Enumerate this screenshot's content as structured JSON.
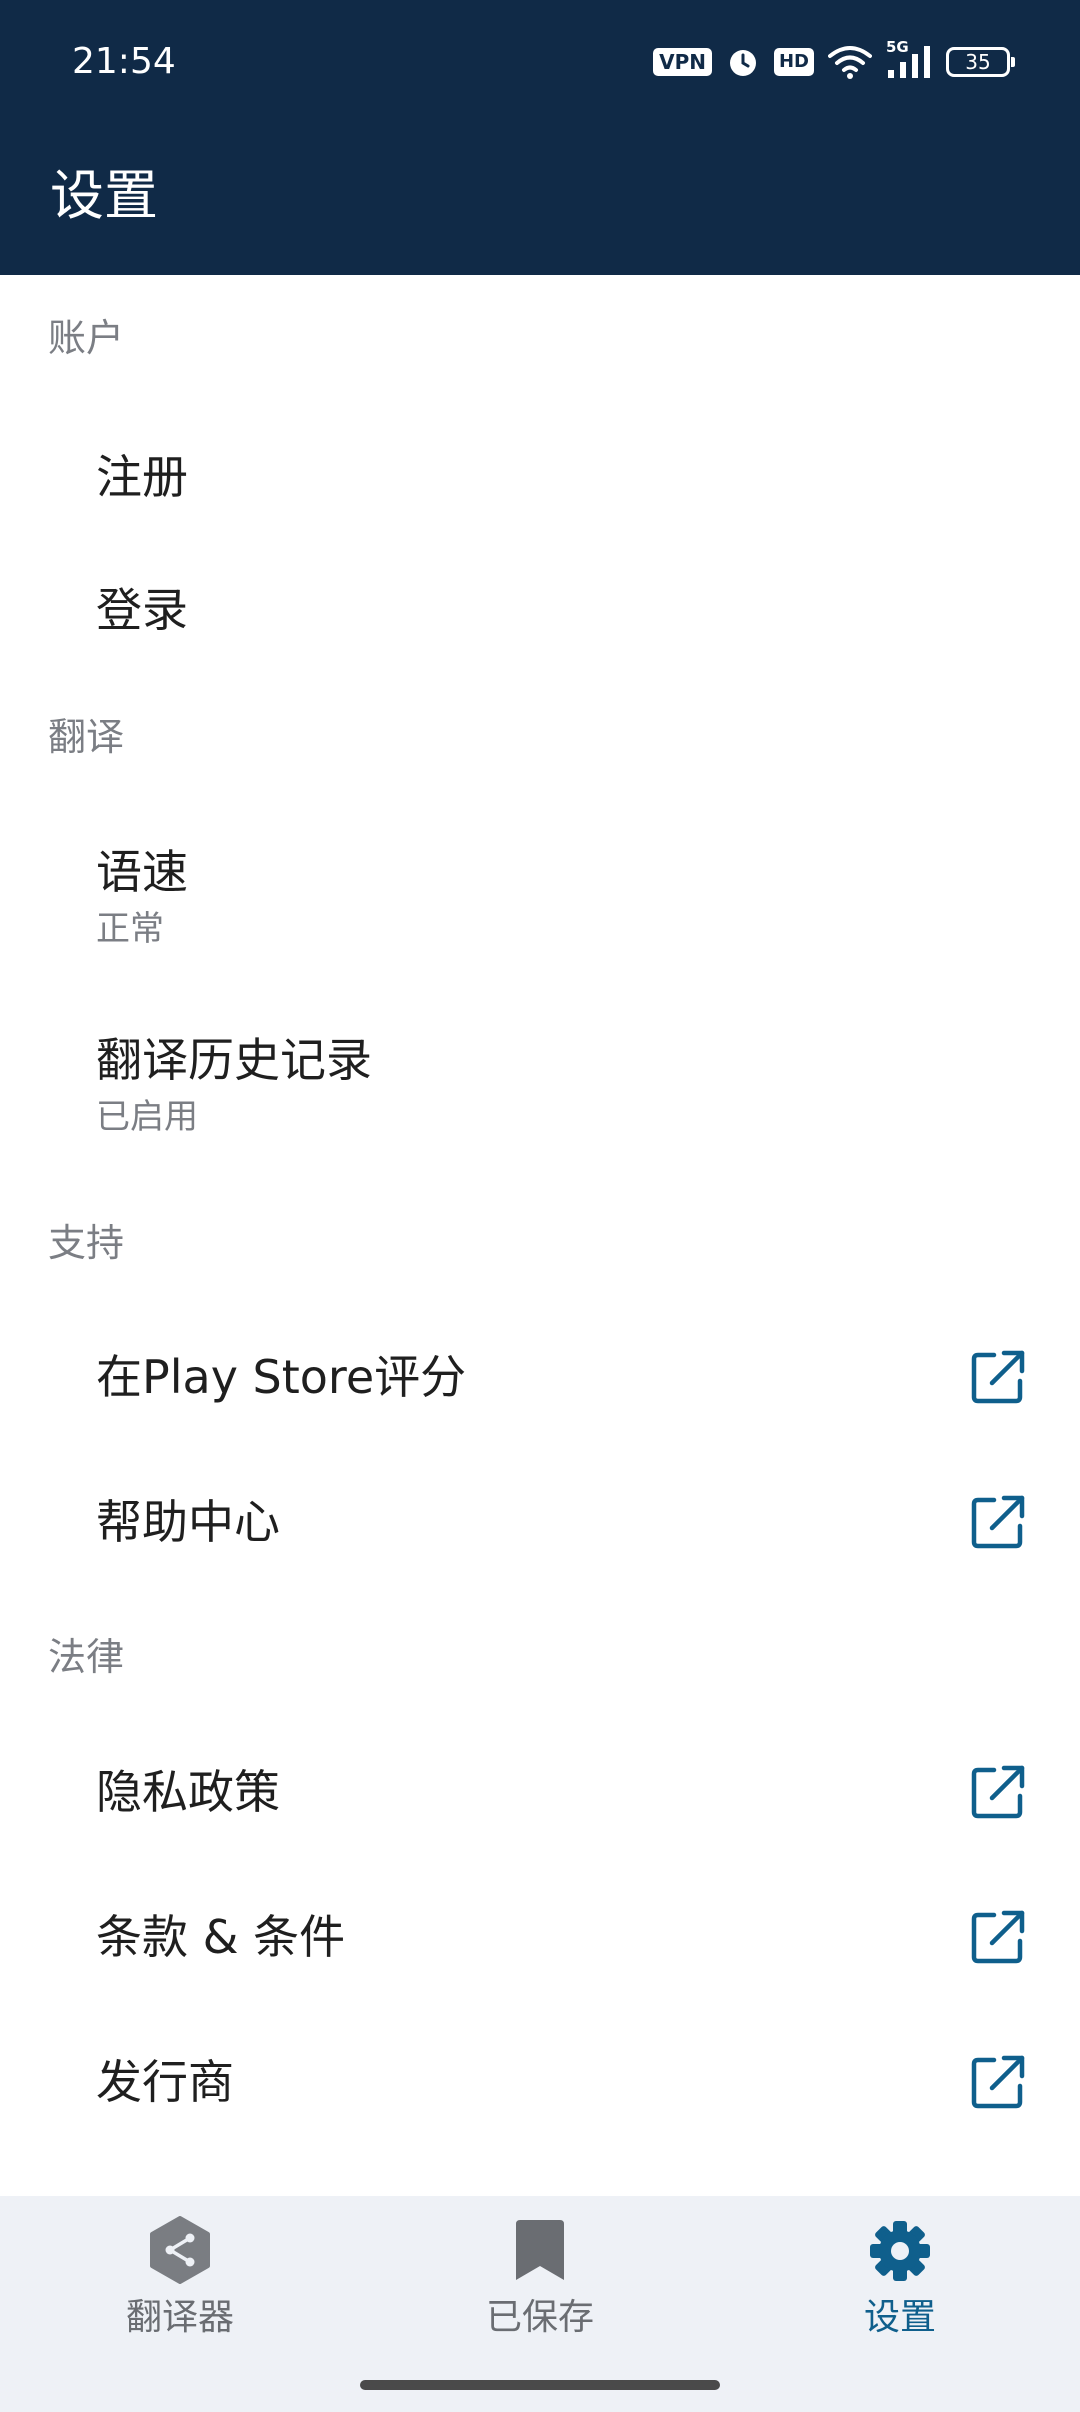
{
  "status_bar": {
    "time": "21:54",
    "vpn": "VPN",
    "hd": "HD",
    "network": "5G",
    "battery": "35"
  },
  "header": {
    "title": "设置"
  },
  "sections": {
    "account": {
      "header": "账户",
      "items": [
        {
          "title": "注册"
        },
        {
          "title": "登录"
        }
      ]
    },
    "translation": {
      "header": "翻译",
      "items": [
        {
          "title": "语速",
          "subtitle": "正常"
        },
        {
          "title": "翻译历史记录",
          "subtitle": "已启用"
        }
      ]
    },
    "support": {
      "header": "支持",
      "items": [
        {
          "title": "在Play Store评分",
          "icon": "external-link-icon"
        },
        {
          "title": "帮助中心",
          "icon": "external-link-icon"
        }
      ]
    },
    "legal": {
      "header": "法律",
      "items": [
        {
          "title": "隐私政策",
          "icon": "external-link-icon"
        },
        {
          "title": "条款 & 条件",
          "icon": "external-link-icon"
        },
        {
          "title": "发行商",
          "icon": "external-link-icon"
        }
      ]
    }
  },
  "bottom_nav": {
    "items": [
      {
        "label": "翻译器",
        "icon": "translator-icon",
        "active": false
      },
      {
        "label": "已保存",
        "icon": "bookmark-icon",
        "active": false
      },
      {
        "label": "设置",
        "icon": "gear-icon",
        "active": true
      }
    ]
  },
  "colors": {
    "header_bg": "#102a47",
    "accent": "#0f5f8c",
    "section_header": "#7b7e84",
    "nav_bg": "#eef1f6"
  }
}
